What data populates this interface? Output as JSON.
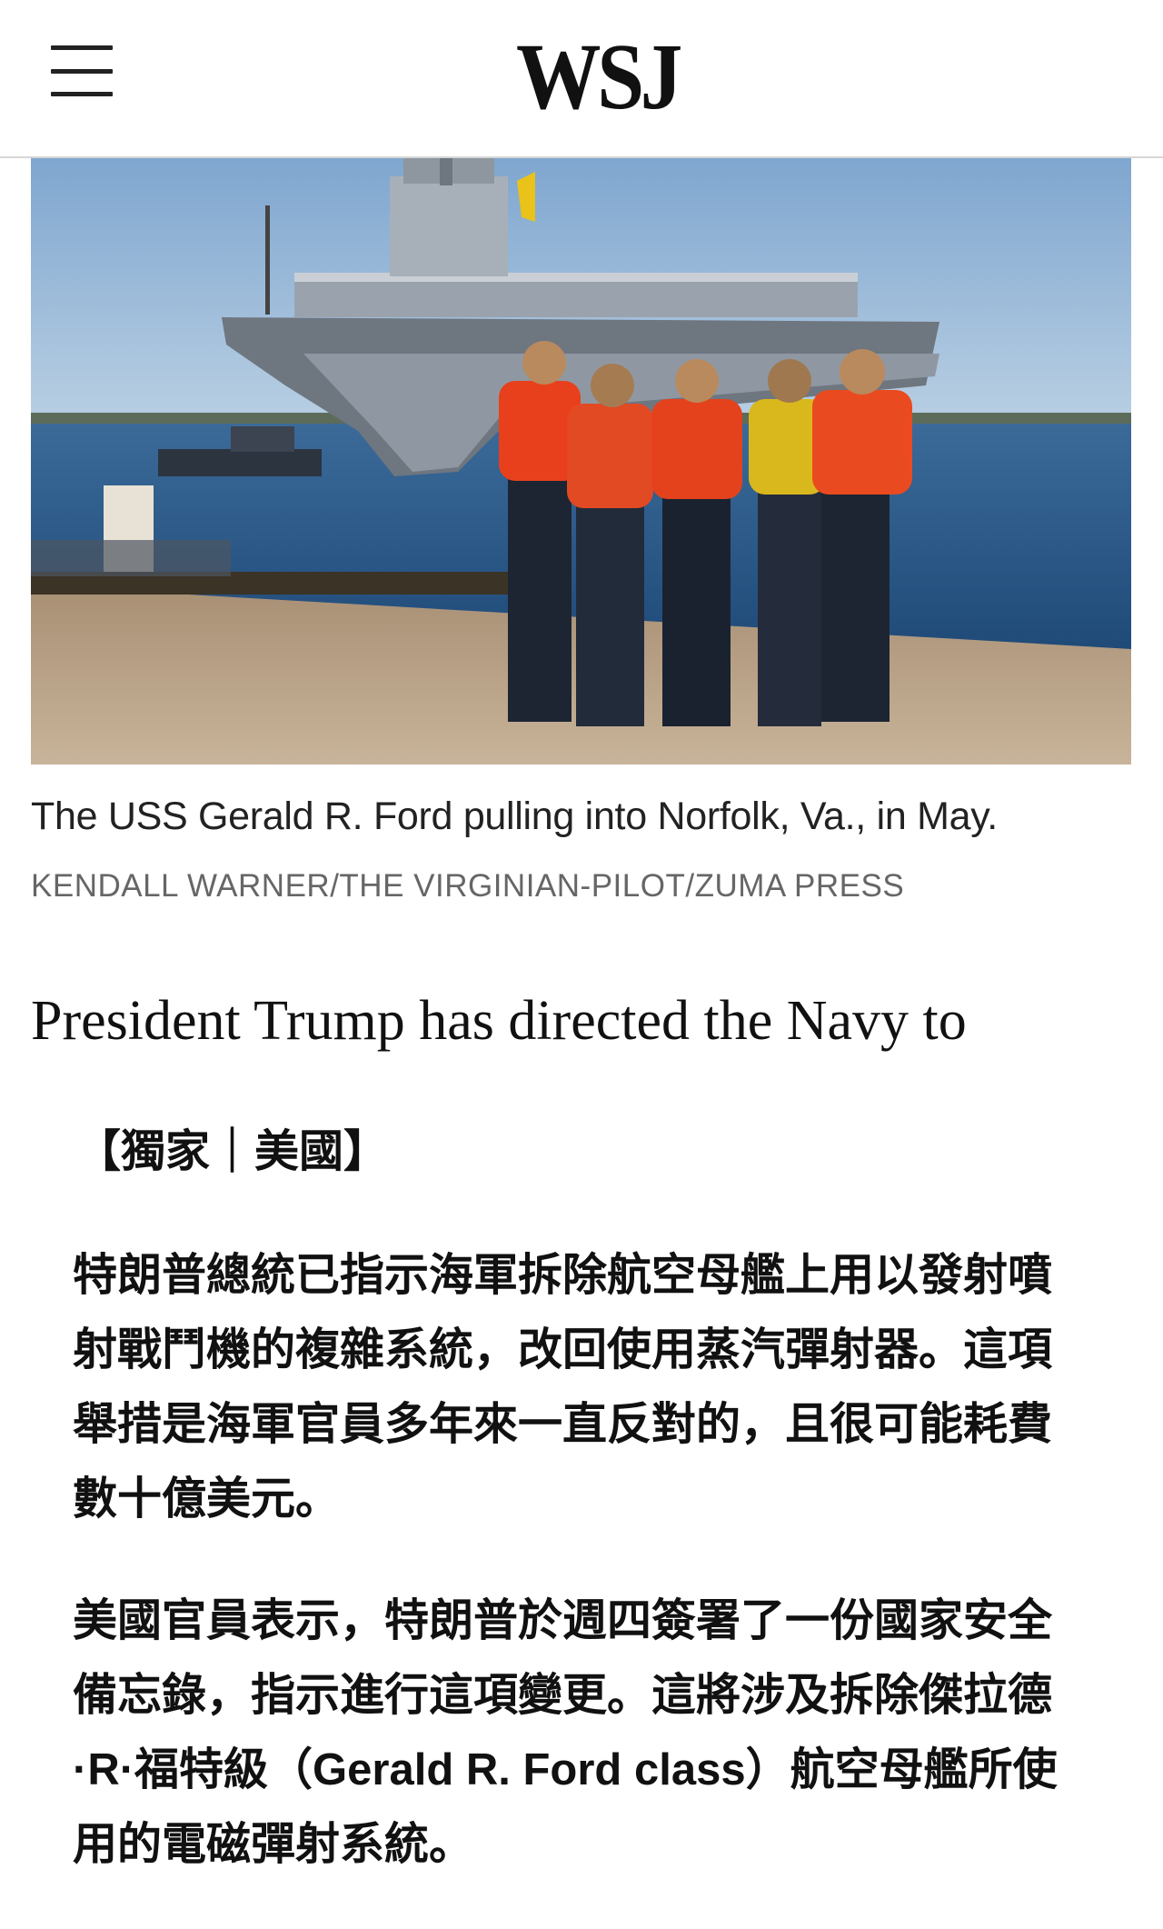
{
  "header": {
    "menu_icon": "hamburger-menu-icon",
    "logo": "WSJ"
  },
  "image": {
    "description_icon": "aircraft-carrier-photo",
    "caption": "The USS Gerald R. Ford pulling into Norfolk, Va., in May.",
    "credit": "KENDALL WARNER/THE VIRGINIAN-PILOT/ZUMA PRESS"
  },
  "article": {
    "lede": "President Trump has directed the Navy to",
    "tag": "【獨家｜美國】",
    "paragraphs": [
      "特朗普總統已指示海軍拆除航空母艦上用以發射噴射戰鬥機的複雜系統，改回使用蒸汽彈射器。這項舉措是海軍官員多年來一直反對的，且很可能耗費數十億美元。",
      "美國官員表示，特朗普於週四簽署了一份國家安全備忘錄，指示進行這項變更。這將涉及拆除傑拉德·R·福特級（Gerald R. Ford class）航空母艦所使用的電磁彈射系統。"
    ]
  },
  "colors": {
    "sky": "#8fb3d4",
    "sea": "#2f5d8a",
    "life_vest": "#e8401c",
    "dock": "#b9a58c"
  }
}
